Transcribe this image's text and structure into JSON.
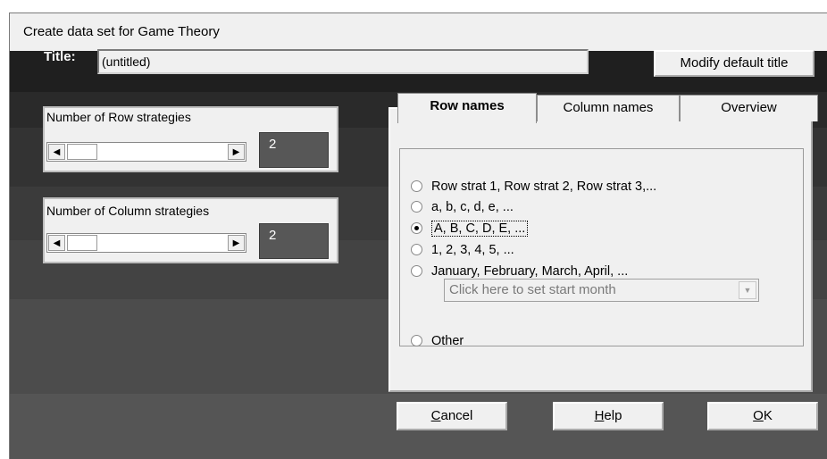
{
  "window": {
    "title": "Create data set for Game Theory"
  },
  "title_row": {
    "label": "Title:",
    "value": "(untitled)",
    "modify_button": "Modify default title"
  },
  "row_strategies": {
    "label": "Number of Row strategies",
    "value": "2"
  },
  "column_strategies": {
    "label": "Number of Column strategies",
    "value": "2"
  },
  "tabs": [
    {
      "label": "Row names",
      "active": true
    },
    {
      "label": "Column names",
      "active": false
    },
    {
      "label": "Overview",
      "active": false
    }
  ],
  "naming_options": [
    {
      "label": "Row strat 1, Row strat 2, Row strat 3,...",
      "selected": false
    },
    {
      "label": "a, b, c, d, e, ...",
      "selected": false
    },
    {
      "label": "A, B, C, D, E, ...",
      "selected": true
    },
    {
      "label": "1, 2, 3, 4, 5, ...",
      "selected": false
    },
    {
      "label": "January, February, March, April, ...",
      "selected": false
    },
    {
      "label": "Other",
      "selected": false
    }
  ],
  "month_combo": {
    "value": "Click here to set start month"
  },
  "buttons": {
    "cancel": {
      "accel": "C",
      "rest": "ancel"
    },
    "help": {
      "accel": "H",
      "rest": "elp"
    },
    "ok": {
      "accel": "O",
      "rest": "K"
    }
  },
  "icons": {
    "scroll_left": "left-arrow-icon",
    "scroll_right": "right-arrow-icon",
    "combo_dropdown": "chevron-down-icon"
  }
}
